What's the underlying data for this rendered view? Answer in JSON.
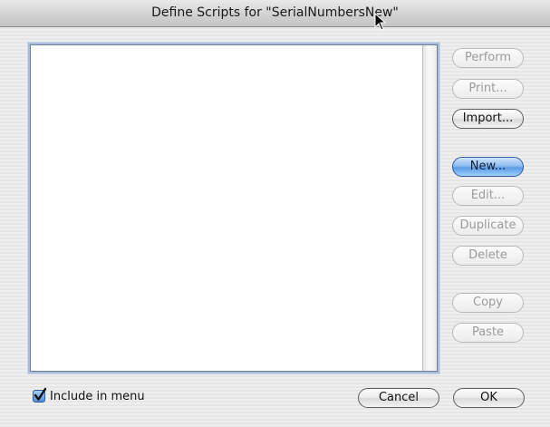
{
  "window": {
    "title": "Define Scripts for \"SerialNumbersNew\""
  },
  "buttons": {
    "perform": "Perform",
    "print": "Print...",
    "import": "Import...",
    "new": "New...",
    "edit": "Edit...",
    "duplicate": "Duplicate",
    "delete": "Delete",
    "copy": "Copy",
    "paste": "Paste",
    "cancel": "Cancel",
    "ok": "OK"
  },
  "include_in_menu": {
    "label": "Include in menu",
    "checked": true
  },
  "icons": {
    "checkmark": "checkmark-icon",
    "cursor": "mouse-pointer-icon"
  }
}
